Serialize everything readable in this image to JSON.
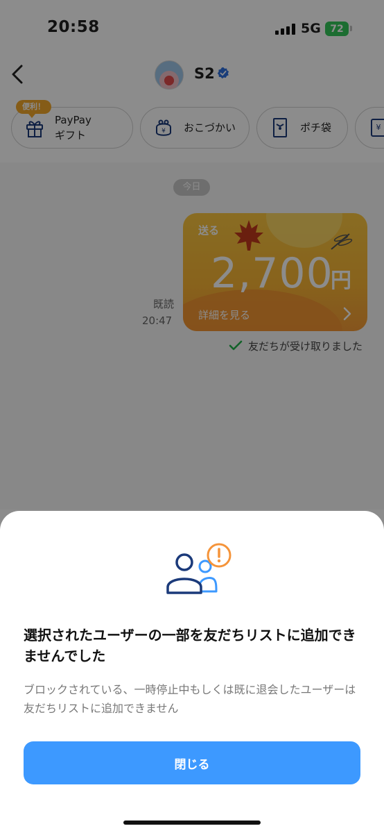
{
  "status_bar": {
    "time": "20:58",
    "network": "5G",
    "battery": "72"
  },
  "nav": {
    "contact_name": "S2"
  },
  "actions": {
    "badge": "便利！",
    "paypay_gift_line1": "PayPay",
    "paypay_gift_line2": "ギフト",
    "okozukai": "おこづかい",
    "pochibukuro": "ポチ袋"
  },
  "chat": {
    "date": "今日",
    "read_label": "既読",
    "time": "20:47",
    "card": {
      "send_label": "送る",
      "amount": "2,700",
      "currency": "円",
      "details_label": "詳細を見る"
    },
    "received_status": "友だちが受け取りました"
  },
  "dialog": {
    "title": "選択されたユーザーの一部を友だちリストに追加できませんでした",
    "description": "ブロックされている、一時停止中もしくは既に退会したユーザーは友だちリストに追加できません",
    "close_label": "閉じる"
  },
  "colors": {
    "primary": "#3d99ff",
    "warning": "#f5943a",
    "user_icon": "#1b3a7a",
    "battery": "#34c759"
  }
}
